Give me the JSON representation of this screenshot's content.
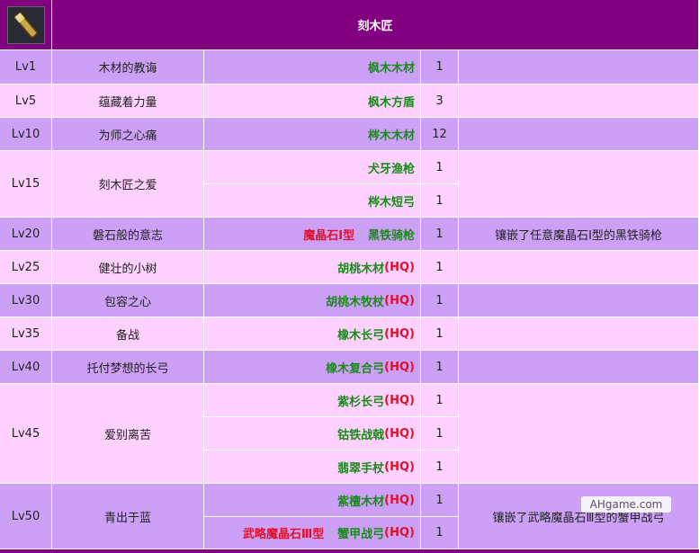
{
  "header": {
    "title": "刻木匠",
    "icon": "carving-knife-icon",
    "colors": {
      "header": "#800080",
      "row_light": "#ffd1ff",
      "row_dark": "#cda0f8",
      "material_green": "#1a8a1a",
      "material_red": "#e0102a"
    }
  },
  "rows": [
    {
      "level": "Lv1",
      "name": "木材的教诲",
      "materials": [
        {
          "parts": [
            {
              "text": "枫木木材",
              "color": "green"
            }
          ],
          "qty": "1"
        }
      ],
      "note": ""
    },
    {
      "level": "Lv5",
      "name": "蕴藏着力量",
      "materials": [
        {
          "parts": [
            {
              "text": "枫木方盾",
              "color": "green"
            }
          ],
          "qty": "3"
        }
      ],
      "note": ""
    },
    {
      "level": "Lv10",
      "name": "为师之心痛",
      "materials": [
        {
          "parts": [
            {
              "text": "梣木木材",
              "color": "green"
            }
          ],
          "qty": "12"
        }
      ],
      "note": ""
    },
    {
      "level": "Lv15",
      "name": "刻木匠之爱",
      "materials": [
        {
          "parts": [
            {
              "text": "犬牙渔枪",
              "color": "green"
            }
          ],
          "qty": "1"
        },
        {
          "parts": [
            {
              "text": "梣木短弓",
              "color": "green"
            }
          ],
          "qty": "1"
        }
      ],
      "note": ""
    },
    {
      "level": "Lv20",
      "name": "磐石般的意志",
      "materials": [
        {
          "parts": [
            {
              "text": "魔晶石Ⅰ型",
              "color": "red"
            },
            {
              "text": "+",
              "color": "plus"
            },
            {
              "text": "黑铁骑枪",
              "color": "green"
            }
          ],
          "qty": "1"
        }
      ],
      "note": "镶嵌了任意魔晶石Ⅰ型的黑铁骑枪"
    },
    {
      "level": "Lv25",
      "name": "健壮的小树",
      "materials": [
        {
          "parts": [
            {
              "text": "胡桃木材",
              "color": "green"
            },
            {
              "text": "(HQ)",
              "color": "red"
            }
          ],
          "qty": "1"
        }
      ],
      "note": ""
    },
    {
      "level": "Lv30",
      "name": "包容之心",
      "materials": [
        {
          "parts": [
            {
              "text": "胡桃木牧杖",
              "color": "green"
            },
            {
              "text": "(HQ)",
              "color": "red"
            }
          ],
          "qty": "1"
        }
      ],
      "note": ""
    },
    {
      "level": "Lv35",
      "name": "备战",
      "materials": [
        {
          "parts": [
            {
              "text": "橡木长弓",
              "color": "green"
            },
            {
              "text": "(HQ)",
              "color": "red"
            }
          ],
          "qty": "1"
        }
      ],
      "note": ""
    },
    {
      "level": "Lv40",
      "name": "托付梦想的长弓",
      "materials": [
        {
          "parts": [
            {
              "text": "橡木复合弓",
              "color": "green"
            },
            {
              "text": "(HQ)",
              "color": "red"
            }
          ],
          "qty": "1"
        }
      ],
      "note": ""
    },
    {
      "level": "Lv45",
      "name": "爱别离苦",
      "materials": [
        {
          "parts": [
            {
              "text": "紫杉长弓",
              "color": "green"
            },
            {
              "text": "(HQ)",
              "color": "red"
            }
          ],
          "qty": "1"
        },
        {
          "parts": [
            {
              "text": "钴铁战戟",
              "color": "green"
            },
            {
              "text": "(HQ)",
              "color": "red"
            }
          ],
          "qty": "1"
        },
        {
          "parts": [
            {
              "text": "翡翠手杖",
              "color": "green"
            },
            {
              "text": "(HQ)",
              "color": "red"
            }
          ],
          "qty": "1"
        }
      ],
      "note": ""
    },
    {
      "level": "Lv50",
      "name": "青出于蓝",
      "materials": [
        {
          "parts": [
            {
              "text": "紫檀木材",
              "color": "green"
            },
            {
              "text": "(HQ)",
              "color": "red"
            }
          ],
          "qty": "1"
        },
        {
          "parts": [
            {
              "text": "武略魔晶石Ⅲ型",
              "color": "red"
            },
            {
              "text": "+",
              "color": "plus"
            },
            {
              "text": "蟹甲战弓",
              "color": "green"
            },
            {
              "text": "(HQ)",
              "color": "red"
            }
          ],
          "qty": "1"
        }
      ],
      "note": "镶嵌了武略魔晶石Ⅲ型的蟹甲战弓"
    }
  ],
  "watermark": "AHgame.com"
}
